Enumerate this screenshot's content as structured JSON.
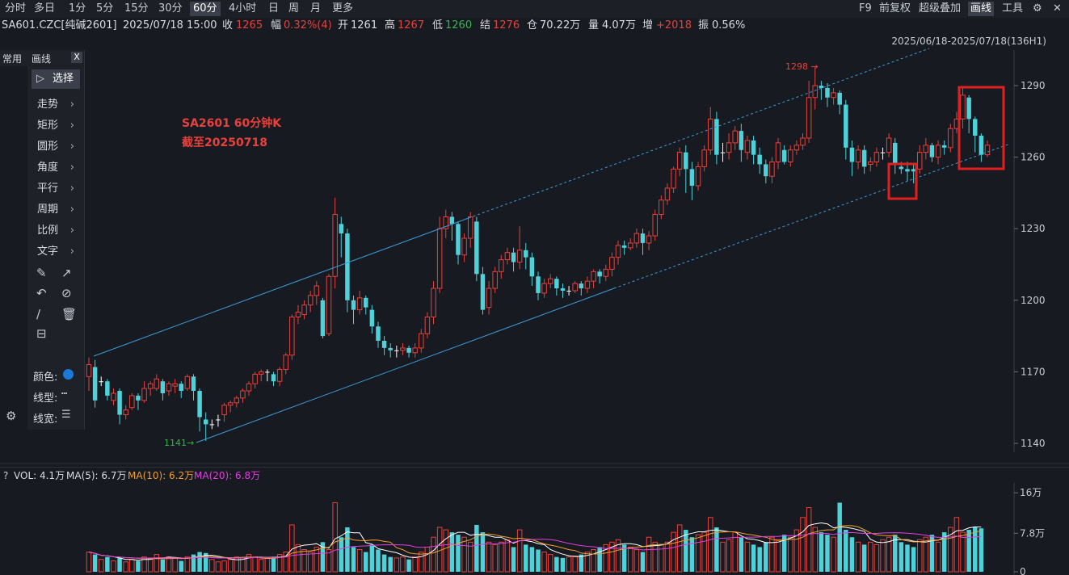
{
  "toolbar": {
    "periods": [
      "分时",
      "多日",
      "1分",
      "5分",
      "15分",
      "30分",
      "60分",
      "4小时",
      "日",
      "周",
      "月",
      "更多"
    ],
    "active_period": "60分",
    "right_items": [
      "F9",
      "前复权",
      "超级叠加",
      "画线",
      "工具"
    ],
    "active_right": "画线"
  },
  "quote": {
    "symbol": "SA601.CZC[纯碱2601]",
    "datetime": "2025/07/18 15:00",
    "close_label": "收",
    "close": "1265",
    "change_label": "幅",
    "change": "0.32%(4)",
    "open_label": "开",
    "open": "1261",
    "high_label": "高",
    "high": "1267",
    "low_label": "低",
    "low": "1260",
    "settle_label": "结",
    "settle": "1276",
    "oi_label": "仓",
    "oi": "70.22万",
    "volume_label": "量",
    "volume": "4.07万",
    "oi_change_label": "增",
    "oi_change": "+2018",
    "amplitude_label": "振",
    "amplitude": "0.56%"
  },
  "date_range": "2025/06/18-2025/07/18(136H1)",
  "draw_panel": {
    "tab_common": "常用",
    "tab_draw": "画线",
    "close": "X",
    "select_label": "选择",
    "tools": [
      "走势",
      "矩形",
      "圆形",
      "角度",
      "平行",
      "周期",
      "比例",
      "文字"
    ],
    "color_label": "颜色:",
    "line_type_label": "线型:",
    "line_width_label": "线宽:",
    "color_value": "#1e78d8"
  },
  "annotation": {
    "line1": "SA2601 60分钟K",
    "line2": "截至20250718"
  },
  "markers": {
    "high_label": "1298",
    "low_label": "1141"
  },
  "volume_panel": {
    "help": "?",
    "vol_label": "VOL: 4.1万",
    "ma5_label": "MA(5): 6.7万",
    "ma10_label": "MA(10): 6.2万",
    "ma20_label": "MA(20): 6.8万",
    "y_labels": [
      "16万",
      "7.8万",
      "0"
    ],
    "ma5_color": "#ffffff",
    "ma10_color": "#f0a030",
    "ma20_color": "#e040e0"
  },
  "chart_data": {
    "type": "candlestick",
    "y_ticks": [
      1140,
      1170,
      1200,
      1230,
      1260,
      1290
    ],
    "ylim": [
      1139,
      1300
    ],
    "candles": [
      [
        1168,
        1173,
        1162,
        1176
      ],
      [
        1172,
        1158,
        1155,
        1175
      ],
      [
        1166,
        1166,
        1164,
        1168
      ],
      [
        1166,
        1160,
        1158,
        1167
      ],
      [
        1158,
        1161,
        1156,
        1163
      ],
      [
        1162,
        1152,
        1148,
        1163
      ],
      [
        1152,
        1154,
        1150,
        1156
      ],
      [
        1155,
        1160,
        1154,
        1161
      ],
      [
        1160,
        1158,
        1154,
        1161
      ],
      [
        1158,
        1163,
        1157,
        1166
      ],
      [
        1163,
        1165,
        1160,
        1166
      ],
      [
        1163,
        1167,
        1162,
        1169
      ],
      [
        1166,
        1161,
        1158,
        1167
      ],
      [
        1162,
        1165,
        1160,
        1166
      ],
      [
        1164,
        1165,
        1161,
        1167
      ],
      [
        1165,
        1162,
        1159,
        1166
      ],
      [
        1163,
        1168,
        1162,
        1169
      ],
      [
        1168,
        1162,
        1158,
        1169
      ],
      [
        1162,
        1151,
        1145,
        1163
      ],
      [
        1150,
        1148,
        1141,
        1153
      ],
      [
        1148,
        1148,
        1146,
        1150
      ],
      [
        1150,
        1150,
        1147,
        1152
      ],
      [
        1152,
        1156,
        1149,
        1157
      ],
      [
        1156,
        1157,
        1153,
        1158
      ],
      [
        1157,
        1159,
        1155,
        1160
      ],
      [
        1159,
        1162,
        1157,
        1163
      ],
      [
        1162,
        1165,
        1160,
        1166
      ],
      [
        1165,
        1169,
        1163,
        1170
      ],
      [
        1169,
        1170,
        1166,
        1171
      ],
      [
        1170,
        1170,
        1166,
        1171
      ],
      [
        1169,
        1166,
        1164,
        1170
      ],
      [
        1166,
        1171,
        1164,
        1172
      ],
      [
        1171,
        1177,
        1169,
        1178
      ],
      [
        1177,
        1193,
        1175,
        1194
      ],
      [
        1193,
        1195,
        1190,
        1198
      ],
      [
        1194,
        1198,
        1192,
        1200
      ],
      [
        1198,
        1202,
        1195,
        1204
      ],
      [
        1202,
        1206,
        1198,
        1208
      ],
      [
        1200,
        1185,
        1184,
        1201
      ],
      [
        1186,
        1210,
        1185,
        1211
      ],
      [
        1210,
        1236,
        1205,
        1243
      ],
      [
        1232,
        1228,
        1218,
        1235
      ],
      [
        1228,
        1200,
        1195,
        1230
      ],
      [
        1200,
        1196,
        1190,
        1202
      ],
      [
        1196,
        1201,
        1194,
        1204
      ],
      [
        1201,
        1197,
        1194,
        1202
      ],
      [
        1196,
        1189,
        1186,
        1198
      ],
      [
        1189,
        1183,
        1180,
        1191
      ],
      [
        1183,
        1180,
        1177,
        1185
      ],
      [
        1180,
        1179,
        1176,
        1182
      ],
      [
        1179,
        1179,
        1176,
        1181
      ],
      [
        1179,
        1180,
        1177,
        1182
      ],
      [
        1180,
        1178,
        1176,
        1181
      ],
      [
        1178,
        1180,
        1176,
        1182
      ],
      [
        1180,
        1186,
        1178,
        1188
      ],
      [
        1186,
        1193,
        1184,
        1195
      ],
      [
        1193,
        1205,
        1190,
        1208
      ],
      [
        1205,
        1230,
        1203,
        1235
      ],
      [
        1230,
        1235,
        1226,
        1238
      ],
      [
        1235,
        1232,
        1225,
        1237
      ],
      [
        1232,
        1219,
        1215,
        1233
      ],
      [
        1219,
        1226,
        1216,
        1228
      ],
      [
        1226,
        1235,
        1222,
        1237
      ],
      [
        1233,
        1211,
        1208,
        1235
      ],
      [
        1211,
        1196,
        1194,
        1214
      ],
      [
        1197,
        1205,
        1194,
        1208
      ],
      [
        1205,
        1212,
        1203,
        1214
      ],
      [
        1212,
        1217,
        1209,
        1219
      ],
      [
        1217,
        1220,
        1215,
        1222
      ],
      [
        1220,
        1216,
        1212,
        1222
      ],
      [
        1216,
        1221,
        1213,
        1231
      ],
      [
        1221,
        1218,
        1213,
        1224
      ],
      [
        1218,
        1210,
        1206,
        1220
      ],
      [
        1210,
        1203,
        1200,
        1212
      ],
      [
        1203,
        1207,
        1201,
        1209
      ],
      [
        1207,
        1209,
        1205,
        1211
      ],
      [
        1209,
        1205,
        1202,
        1210
      ],
      [
        1205,
        1204,
        1201,
        1207
      ],
      [
        1204,
        1204,
        1202,
        1206
      ],
      [
        1204,
        1207,
        1203,
        1208
      ],
      [
        1207,
        1205,
        1202,
        1208
      ],
      [
        1205,
        1208,
        1203,
        1210
      ],
      [
        1208,
        1212,
        1205,
        1213
      ],
      [
        1212,
        1210,
        1207,
        1213
      ],
      [
        1210,
        1213,
        1208,
        1215
      ],
      [
        1213,
        1218,
        1210,
        1220
      ],
      [
        1218,
        1223,
        1215,
        1225
      ],
      [
        1223,
        1222,
        1219,
        1225
      ],
      [
        1222,
        1224,
        1221,
        1226
      ],
      [
        1224,
        1228,
        1222,
        1230
      ],
      [
        1228,
        1224,
        1219,
        1230
      ],
      [
        1224,
        1227,
        1221,
        1229
      ],
      [
        1227,
        1236,
        1225,
        1238
      ],
      [
        1236,
        1242,
        1234,
        1244
      ],
      [
        1242,
        1247,
        1240,
        1249
      ],
      [
        1247,
        1255,
        1245,
        1256
      ],
      [
        1255,
        1262,
        1252,
        1264
      ],
      [
        1262,
        1255,
        1245,
        1265
      ],
      [
        1255,
        1248,
        1242,
        1258
      ],
      [
        1248,
        1256,
        1246,
        1258
      ],
      [
        1256,
        1263,
        1254,
        1265
      ],
      [
        1263,
        1276,
        1261,
        1281
      ],
      [
        1276,
        1261,
        1257,
        1279
      ],
      [
        1262,
        1262,
        1258,
        1266
      ],
      [
        1262,
        1266,
        1259,
        1270
      ],
      [
        1266,
        1271,
        1263,
        1273
      ],
      [
        1271,
        1263,
        1258,
        1274
      ],
      [
        1262,
        1267,
        1259,
        1269
      ],
      [
        1267,
        1261,
        1257,
        1269
      ],
      [
        1261,
        1257,
        1253,
        1264
      ],
      [
        1257,
        1252,
        1249,
        1259
      ],
      [
        1252,
        1258,
        1249,
        1260
      ],
      [
        1258,
        1266,
        1255,
        1268
      ],
      [
        1263,
        1258,
        1257,
        1265
      ],
      [
        1258,
        1263,
        1256,
        1265
      ],
      [
        1263,
        1265,
        1261,
        1267
      ],
      [
        1265,
        1268,
        1263,
        1270
      ],
      [
        1268,
        1285,
        1266,
        1292
      ],
      [
        1285,
        1290,
        1280,
        1298
      ],
      [
        1290,
        1289,
        1284,
        1292
      ],
      [
        1289,
        1285,
        1281,
        1291
      ],
      [
        1285,
        1287,
        1282,
        1289
      ],
      [
        1287,
        1282,
        1278,
        1288
      ],
      [
        1282,
        1264,
        1259,
        1284
      ],
      [
        1264,
        1258,
        1252,
        1267
      ],
      [
        1258,
        1263,
        1255,
        1265
      ],
      [
        1263,
        1256,
        1253,
        1265
      ],
      [
        1257,
        1258,
        1254,
        1260
      ],
      [
        1258,
        1262,
        1256,
        1264
      ],
      [
        1262,
        1262,
        1259,
        1264
      ],
      [
        1262,
        1268,
        1260,
        1270
      ],
      [
        1266,
        1257,
        1253,
        1268
      ],
      [
        1256,
        1255,
        1253,
        1258
      ],
      [
        1255,
        1254,
        1250,
        1258
      ],
      [
        1255,
        1254,
        1249,
        1257
      ],
      [
        1255,
        1262,
        1253,
        1265
      ],
      [
        1262,
        1265,
        1259,
        1268
      ],
      [
        1265,
        1260,
        1258,
        1266
      ],
      [
        1260,
        1265,
        1257,
        1267
      ],
      [
        1265,
        1264,
        1261,
        1267
      ],
      [
        1264,
        1272,
        1262,
        1274
      ],
      [
        1272,
        1276,
        1270,
        1279
      ],
      [
        1276,
        1286,
        1272,
        1289
      ],
      [
        1285,
        1276,
        1270,
        1286
      ],
      [
        1276,
        1269,
        1262,
        1277
      ],
      [
        1269,
        1261,
        1258,
        1270
      ],
      [
        1261,
        1265,
        1260,
        1267
      ]
    ],
    "volumes": [
      40,
      35,
      25,
      30,
      22,
      28,
      20,
      25,
      22,
      30,
      28,
      35,
      25,
      30,
      28,
      22,
      30,
      35,
      40,
      38,
      25,
      20,
      22,
      25,
      30,
      28,
      35,
      30,
      25,
      28,
      30,
      35,
      40,
      95,
      55,
      45,
      40,
      50,
      60,
      45,
      140,
      70,
      90,
      50,
      45,
      40,
      55,
      45,
      35,
      30,
      28,
      30,
      25,
      30,
      40,
      50,
      70,
      90,
      85,
      80,
      75,
      70,
      60,
      95,
      80,
      60,
      55,
      60,
      65,
      50,
      85,
      55,
      50,
      45,
      40,
      35,
      30,
      28,
      30,
      32,
      35,
      40,
      45,
      50,
      55,
      60,
      65,
      55,
      50,
      45,
      40,
      70,
      60,
      55,
      60,
      80,
      95,
      85,
      70,
      75,
      80,
      110,
      90,
      60,
      65,
      80,
      70,
      60,
      55,
      50,
      60,
      70,
      65,
      75,
      70,
      85,
      110,
      130,
      90,
      80,
      75,
      70,
      140,
      85,
      70,
      60,
      55,
      60,
      55,
      65,
      70,
      75,
      60,
      55,
      50,
      65,
      70,
      75,
      60,
      80,
      90,
      110,
      80,
      85,
      90,
      88
    ]
  }
}
